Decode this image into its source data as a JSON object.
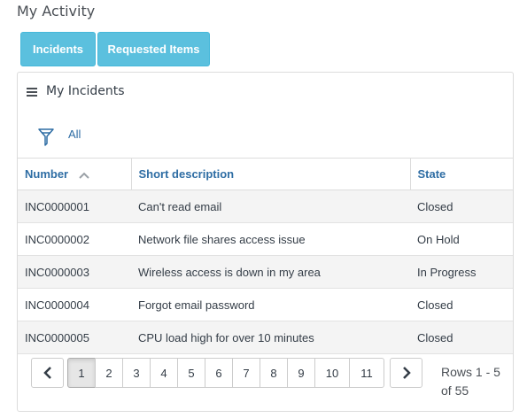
{
  "page": {
    "title": "My Activity"
  },
  "tabs": [
    {
      "label": "Incidents"
    },
    {
      "label": "Requested Items"
    }
  ],
  "panel": {
    "title": "My Incidents",
    "menu_icon": "hamburger-menu-icon",
    "filter_icon": "funnel-filter-icon",
    "filter_label": "All"
  },
  "table": {
    "columns": [
      "Number",
      "Short description",
      "State"
    ],
    "sort_icon": "chevron-up-icon",
    "rows": [
      {
        "number": "INC0000001",
        "description": "Can't read email",
        "state": "Closed"
      },
      {
        "number": "INC0000002",
        "description": "Network file shares access issue",
        "state": "On Hold"
      },
      {
        "number": "INC0000003",
        "description": "Wireless access is down in my area",
        "state": "In Progress"
      },
      {
        "number": "INC0000004",
        "description": "Forgot email password",
        "state": "Closed"
      },
      {
        "number": "INC0000005",
        "description": "CPU load high for over 10 minutes",
        "state": "Closed"
      }
    ]
  },
  "pagination": {
    "prev_icon": "chevron-left-icon",
    "next_icon": "chevron-right-icon",
    "pages": [
      "1",
      "2",
      "3",
      "4",
      "5",
      "6",
      "7",
      "8",
      "9",
      "10",
      "11"
    ],
    "current_page": "1",
    "rows_info_line1": "Rows 1 - 5",
    "rows_info_line2": "of 55"
  },
  "colors": {
    "tab_background": "#5bc0de",
    "link_blue": "#2e6da4",
    "row_alt": "#f4f4f4"
  }
}
